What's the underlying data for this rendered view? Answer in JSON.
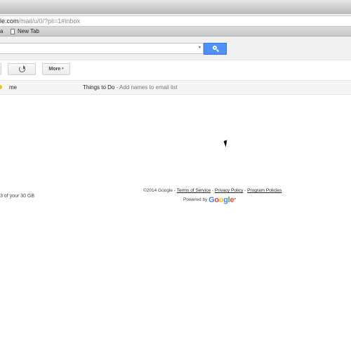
{
  "browser": {
    "url_host": "le.com",
    "url_path": "/mail/u/0/?pli=1#inbox",
    "bookmarks": {
      "fragment": "a",
      "new_tab": "New Tab"
    }
  },
  "toolbar": {
    "more_label": "More",
    "more_caret": "▾"
  },
  "search": {
    "placeholder": "",
    "caret": "▾"
  },
  "inbox": {
    "rows": [
      {
        "sender": "me",
        "subject": "Things to Do",
        "snippet": " - Add names to email list"
      }
    ]
  },
  "storage": {
    "text": "3 of your 30 GB"
  },
  "footer": {
    "copyright": "©2014 Google",
    "sep": " - ",
    "terms": "Terms of Service",
    "privacy": "Privacy Policy",
    "program": "Program Policies",
    "powered_by": "Powered by ",
    "logo_letters": [
      "G",
      "o",
      "o",
      "g",
      "l",
      "e"
    ]
  },
  "colors": {
    "accent": "#4d90fe",
    "star": "#f4c20d"
  }
}
